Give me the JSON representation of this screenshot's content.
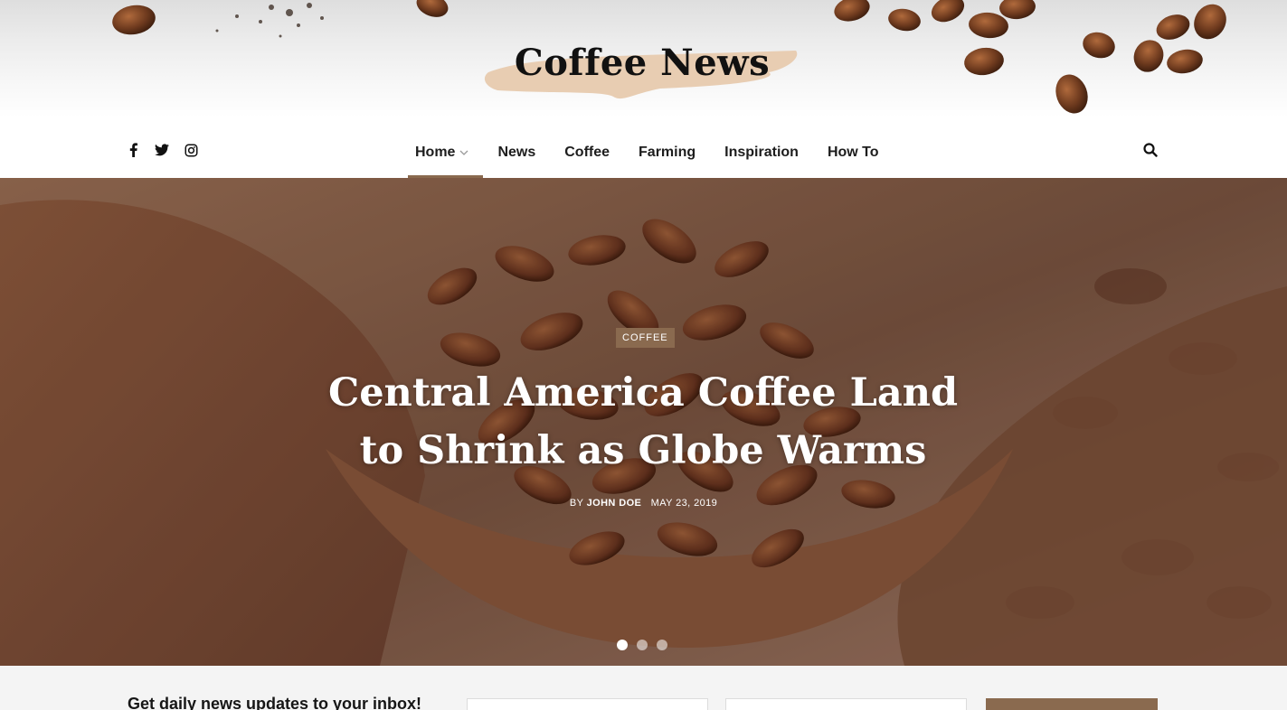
{
  "site": {
    "logo_text": "Coffee News"
  },
  "nav": {
    "social_icons": [
      "facebook-icon",
      "twitter-icon",
      "instagram-icon"
    ],
    "items": [
      {
        "label": "Home",
        "active": true,
        "has_dropdown": true
      },
      {
        "label": "News"
      },
      {
        "label": "Coffee"
      },
      {
        "label": "Farming"
      },
      {
        "label": "Inspiration"
      },
      {
        "label": "How To"
      }
    ],
    "search_icon": "search-icon"
  },
  "hero": {
    "category": "COFFEE",
    "title": "Central America Coffee Land to Shrink as Globe Warms",
    "by_prefix": "BY",
    "author": "JOHN DOE",
    "date": "MAY 23, 2019",
    "slides_total": 3,
    "active_slide": 1
  },
  "newsletter": {
    "title": "Get daily news updates to your inbox!"
  },
  "colors": {
    "accent": "#8a6a4f",
    "text": "#1d1d1d"
  }
}
